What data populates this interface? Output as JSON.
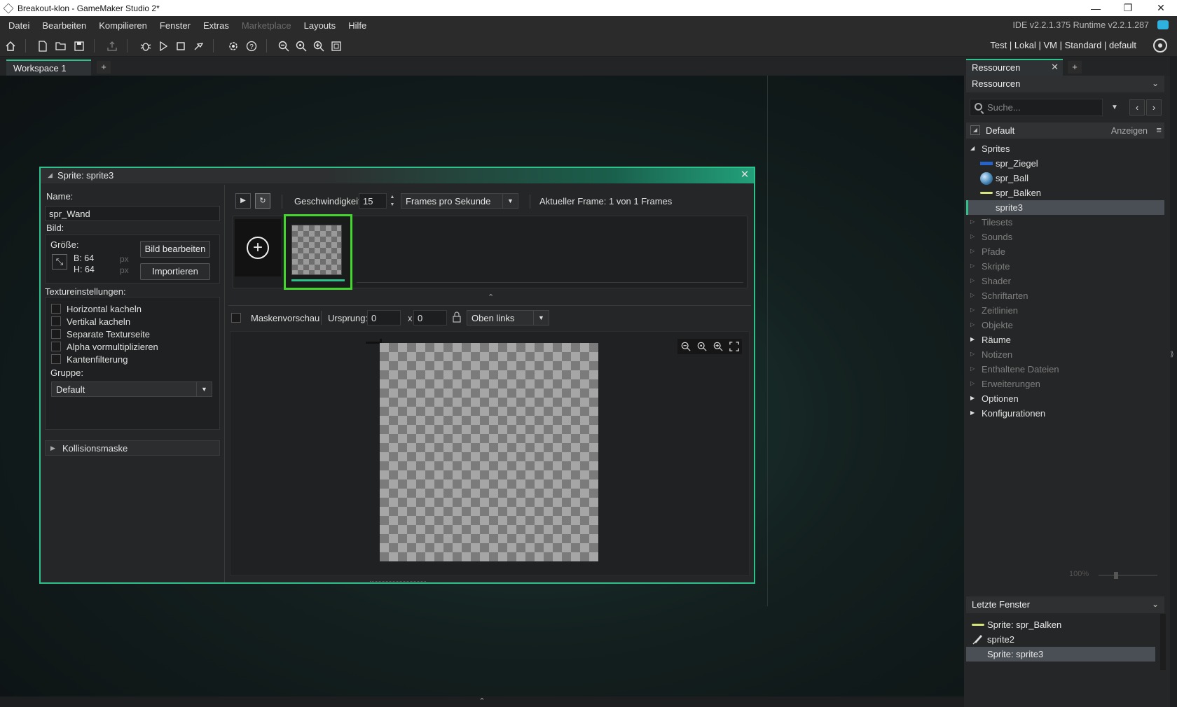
{
  "window": {
    "title": "Breakout-klon - GameMaker Studio 2*",
    "minimize": "—",
    "restore": "❐",
    "close": "✕"
  },
  "menu": [
    "Datei",
    "Bearbeiten",
    "Kompilieren",
    "Fenster",
    "Extras",
    "Marketplace",
    "Layouts",
    "Hilfe"
  ],
  "ide_version": "IDE v2.2.1.375 Runtime v2.2.1.287",
  "target_bar": "Test | Lokal | VM | Standard | default",
  "workspace": {
    "tab": "Workspace 1",
    "add": "+"
  },
  "sprite_editor": {
    "title": "Sprite: sprite3",
    "close": "✕",
    "name_label": "Name:",
    "name_value": "spr_Wand",
    "image_label": "Bild:",
    "size_label": "Größe:",
    "width": "B: 64",
    "height": "H: 64",
    "px": "px",
    "edit_image": "Bild bearbeiten",
    "import": "Importieren",
    "texture_settings": "Textureinstellungen:",
    "checkboxes": [
      "Horizontal kacheln",
      "Vertikal kacheln",
      "Separate Texturseite",
      "Alpha vormultiplizieren",
      "Kantenfilterung"
    ],
    "group_label": "Gruppe:",
    "group_value": "Default",
    "collision_mask": "Kollisionsmaske",
    "speed_label": "Geschwindigkeit:",
    "speed_value": "15",
    "speed_unit": "Frames pro Sekunde",
    "current_frame": "Aktueller Frame: 1 von 1 Frames",
    "mask_preview": "Maskenvorschau",
    "origin_label": "Ursprung:",
    "origin_x": "0",
    "origin_y": "0",
    "origin_sep": "x",
    "origin_preset": "Oben links"
  },
  "resources": {
    "tab": "Ressourcen",
    "tab_close": "✕",
    "add": "+",
    "header": "Ressourcen",
    "search_placeholder": "Suche...",
    "group": "Default",
    "show": "Anzeigen",
    "sprites_folder": "Sprites",
    "sprites": [
      "spr_Ziegel",
      "spr_Ball",
      "spr_Balken",
      "sprite3"
    ],
    "folders": [
      "Tilesets",
      "Sounds",
      "Pfade",
      "Skripte",
      "Shader",
      "Schriftarten",
      "Zeitlinien",
      "Objekte",
      "Räume",
      "Notizen",
      "Enthaltene Dateien",
      "Erweiterungen",
      "Optionen",
      "Konfigurationen"
    ],
    "zoom": "100%"
  },
  "recent": {
    "header": "Letzte Fenster",
    "items": [
      "Sprite: spr_Balken",
      "sprite2",
      "Sprite: sprite3"
    ]
  },
  "colors": {
    "accent": "#2fc18c",
    "frame_highlight": "#44d62c"
  }
}
